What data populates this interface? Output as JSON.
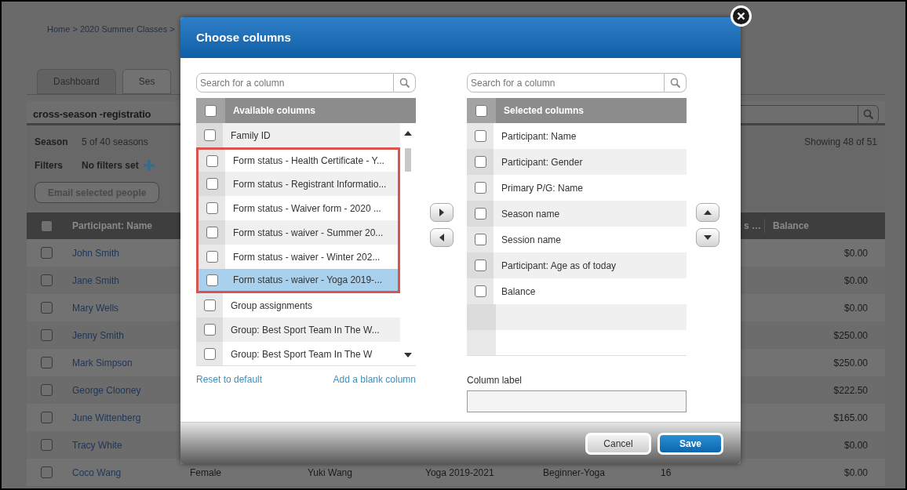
{
  "breadcrumb": "Home > 2020 Summer Classes >",
  "tabs": [
    {
      "label": "Dashboard",
      "selected": false
    },
    {
      "label": "Ses",
      "selected": true
    }
  ],
  "report_title": "cross-season -registratio",
  "season": {
    "label": "Season",
    "value": "5 of 40 seasons"
  },
  "filters": {
    "label": "Filters",
    "value": "No filters set"
  },
  "email_button": "Email selected people",
  "showing": "Showing 48 of 51",
  "table": {
    "header_checked": false,
    "columns": [
      "Participant: Name",
      "s …",
      "Balance"
    ],
    "rows": [
      {
        "checked": false,
        "name": "John Smith",
        "balance": "$0.00"
      },
      {
        "checked": false,
        "name": "Jane Smith",
        "balance": "$0.00"
      },
      {
        "checked": false,
        "name": "Mary Wells",
        "balance": "$0.00"
      },
      {
        "checked": false,
        "name": "Jenny Smith",
        "balance": "$250.00"
      },
      {
        "checked": false,
        "name": "Mark Simpson",
        "balance": "$250.00"
      },
      {
        "checked": false,
        "name": "George Clooney",
        "balance": "$222.50"
      },
      {
        "checked": false,
        "name": "June Wittenberg",
        "balance": "$165.00"
      },
      {
        "checked": false,
        "name": "Tracy White",
        "balance": "$0.00"
      },
      {
        "checked": false,
        "name": "Coco Wang",
        "cells": [
          "Female",
          "Yuki Wang",
          "Yoga 2019-2021",
          "Beginner-Yoga",
          "16"
        ],
        "balance": "$0.00"
      }
    ]
  },
  "dialog": {
    "title": "Choose columns",
    "available": {
      "placeholder": "Search for a column",
      "header": "Available columns",
      "header_checked": false,
      "items": [
        {
          "label": "Family ID",
          "checked": false,
          "selected": false
        },
        {
          "label": "Form status - Health Certificate - Y...",
          "checked": false,
          "selected": false,
          "highlighted": true
        },
        {
          "label": "Form status - Registrant Informatio...",
          "checked": false,
          "selected": false,
          "highlighted": true
        },
        {
          "label": "Form status - Waiver form - 2020 ...",
          "checked": false,
          "selected": false,
          "highlighted": true
        },
        {
          "label": "Form status - waiver - Summer 20...",
          "checked": false,
          "selected": false,
          "highlighted": true
        },
        {
          "label": "Form status - waiver - Winter 202...",
          "checked": false,
          "selected": false,
          "highlighted": true
        },
        {
          "label": "Form status - waiver - Yoga 2019-...",
          "checked": false,
          "selected": true,
          "highlighted": true
        },
        {
          "label": "Group assignments",
          "checked": false,
          "selected": false
        },
        {
          "label": "Group: Best Sport Team In The W...",
          "checked": false,
          "selected": false
        },
        {
          "label": "Group: Best Sport Team In The W",
          "checked": false,
          "selected": false
        }
      ]
    },
    "selected": {
      "placeholder": "Search for a column",
      "header": "Selected columns",
      "header_checked": false,
      "items": [
        {
          "label": "Participant: Name",
          "checked": false,
          "selected": false
        },
        {
          "label": "Participant: Gender",
          "checked": false,
          "selected": false
        },
        {
          "label": "Primary P/G: Name",
          "checked": false,
          "selected": false
        },
        {
          "label": "Season name",
          "checked": false,
          "selected": false
        },
        {
          "label": "Session name",
          "checked": false,
          "selected": false
        },
        {
          "label": "Participant: Age as of today",
          "checked": false,
          "selected": false
        },
        {
          "label": "Balance",
          "checked": false,
          "selected": false
        }
      ]
    },
    "reset_link": "Reset to default",
    "add_link": "Add a blank column",
    "column_label": {
      "label": "Column label"
    },
    "buttons": [
      {
        "label": "Cancel",
        "kind": "secondary"
      },
      {
        "label": "Save",
        "kind": "primary"
      }
    ]
  }
}
